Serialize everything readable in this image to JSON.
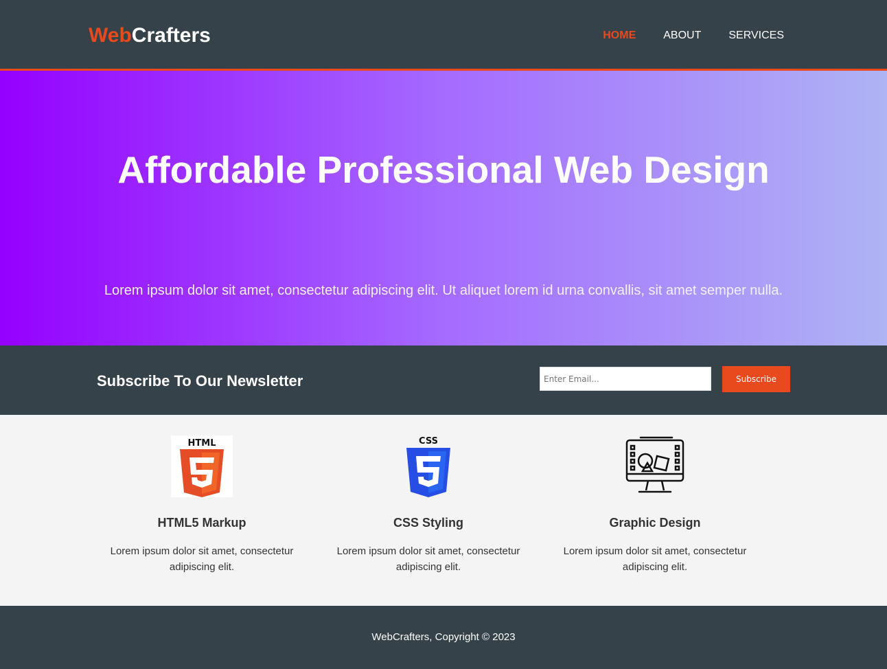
{
  "header": {
    "logo_highlight": "Web",
    "logo_rest": "Crafters",
    "nav": [
      {
        "label": "HOME",
        "active": true
      },
      {
        "label": "ABOUT",
        "active": false
      },
      {
        "label": "SERVICES",
        "active": false
      }
    ]
  },
  "hero": {
    "title": "Affordable Professional Web Design",
    "subtitle": "Lorem ipsum dolor sit amet, consectetur adipiscing elit. Ut aliquet lorem id urna convallis, sit amet semper nulla."
  },
  "newsletter": {
    "heading": "Subscribe To Our Newsletter",
    "email_placeholder": "Enter Email...",
    "button_label": "Subscribe"
  },
  "boxes": [
    {
      "icon": "html5-icon",
      "icon_label": "HTML",
      "title": "HTML5 Markup",
      "text": "Lorem ipsum dolor sit amet, consectetur adipiscing elit."
    },
    {
      "icon": "css3-icon",
      "icon_label": "CSS",
      "title": "CSS Styling",
      "text": "Lorem ipsum dolor sit amet, consectetur adipiscing elit."
    },
    {
      "icon": "graphic-design-monitor-icon",
      "title": "Graphic Design",
      "text": "Lorem ipsum dolor sit amet, consectetur adipiscing elit."
    }
  ],
  "footer": {
    "copyright": "WebCrafters, Copyright © 2023"
  },
  "colors": {
    "accent": "#e8491d",
    "dark": "#35424a",
    "light_bg": "#f4f4f4",
    "hero_gradient": [
      "#9500ff",
      "#a56bff",
      "#aeb4f4"
    ]
  }
}
